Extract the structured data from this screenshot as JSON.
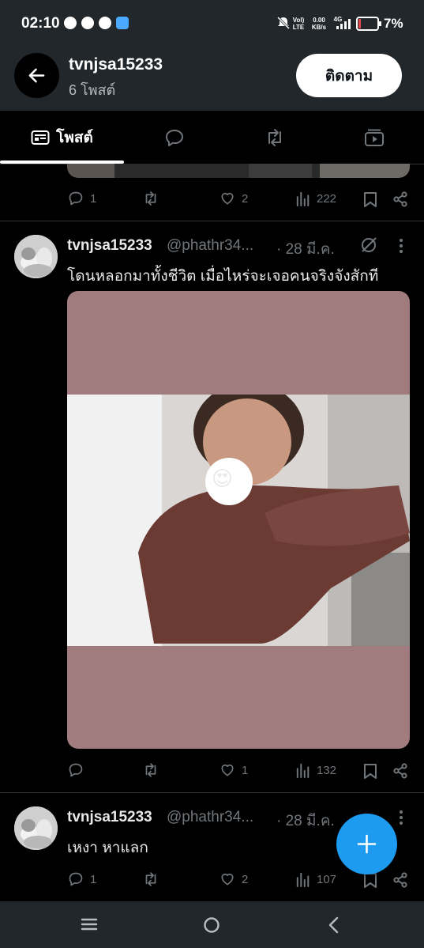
{
  "status_bar": {
    "time": "02:10",
    "net_top": "Vol)",
    "net_bottom": "LTE",
    "speed_top": "0.00",
    "speed_bottom": "KB/s",
    "signal_type": "4G",
    "battery": "7%"
  },
  "header": {
    "name": "tvnjsa15233",
    "post_count": "6 โพสต์",
    "follow_label": "ติดตาม"
  },
  "tabs": [
    {
      "label": "โพสต์",
      "icon": "posts-icon",
      "active": true
    },
    {
      "icon": "replies-icon"
    },
    {
      "icon": "reposts-icon"
    },
    {
      "icon": "media-icon"
    }
  ],
  "posts": [
    {
      "replies": "1",
      "reposts": "",
      "likes": "2",
      "views": "222"
    },
    {
      "name": "tvnjsa15233",
      "handle": "@phathr34...",
      "date": "· 28 มี.ค.",
      "text": "โดนหลอกมาทั้งชีวิต เมื่อไหร่จะเจอคนจริงจังสักที",
      "media_sticker": "😍",
      "replies": "",
      "reposts": "",
      "likes": "1",
      "views": "132"
    },
    {
      "name": "tvnjsa15233",
      "handle": "@phathr34...",
      "date": "· 28 มี.ค.",
      "text": "เหงา หาแลก",
      "replies": "1",
      "reposts": "",
      "likes": "2",
      "views": "107"
    }
  ],
  "colors": {
    "accent": "#1d9bf0",
    "bar_bg": "#22272b",
    "muted": "#71767b",
    "media_bg": "#a17c7f"
  }
}
